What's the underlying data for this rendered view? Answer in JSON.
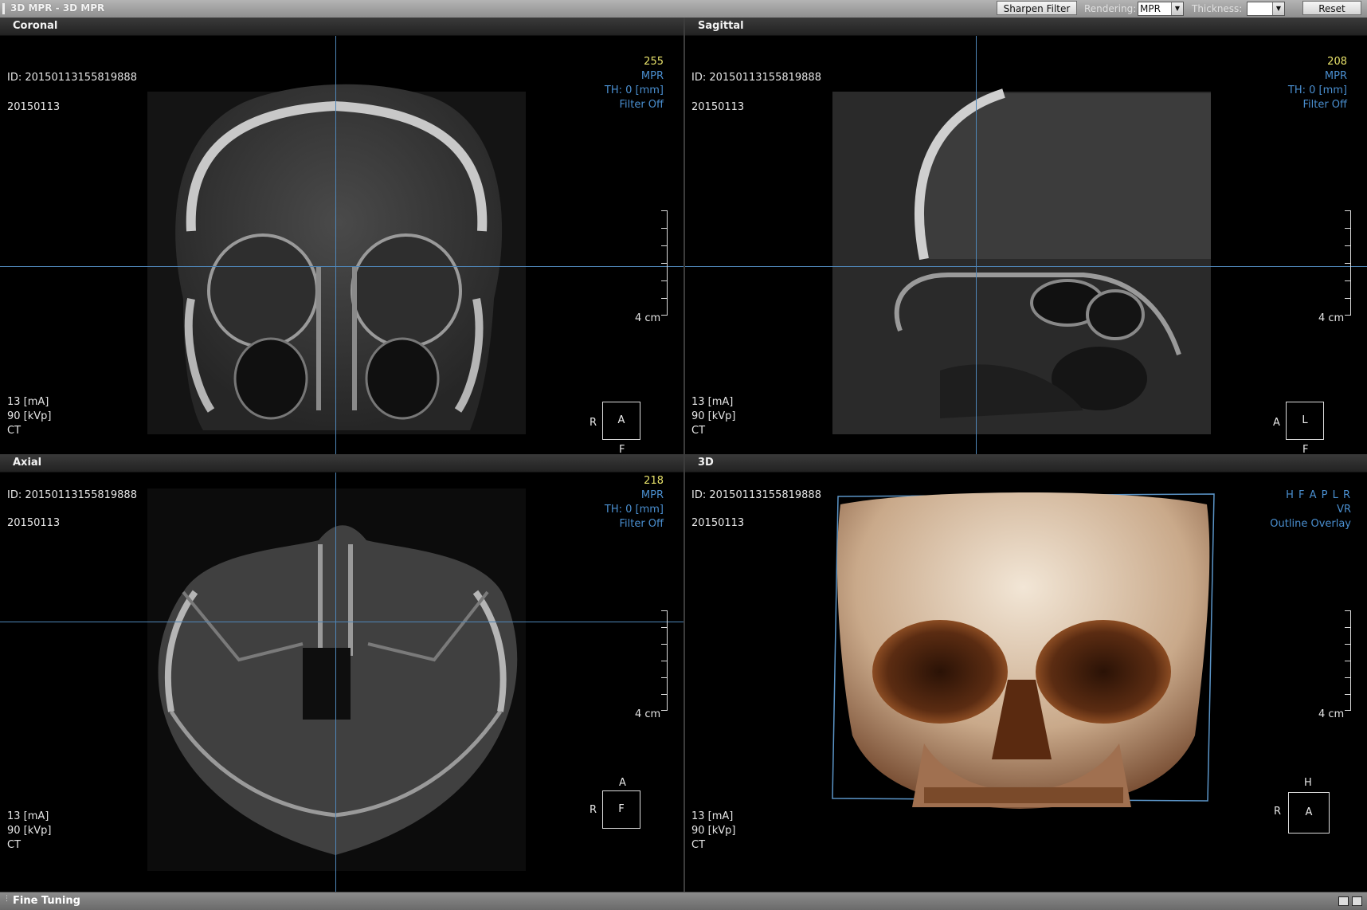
{
  "window": {
    "title": "3D MPR - 3D MPR",
    "sharpen_label": "Sharpen Filter",
    "rendering_label": "Rendering:",
    "rendering_value": "MPR",
    "thickness_label": "Thickness:",
    "thickness_value": "",
    "reset_label": "Reset"
  },
  "common": {
    "id": "ID: 20150113155819888",
    "date": "20150113",
    "ma": "13 [mA]",
    "kvp": "90 [kVp]",
    "modality": "CT",
    "scale": "4 cm"
  },
  "coronal": {
    "title": "Coronal",
    "slice": "255",
    "mode": "MPR",
    "th": "TH: 0 [mm]",
    "filter": "Filter Off",
    "orient_left": "R",
    "orient_center": "A",
    "orient_bottom": "F"
  },
  "sagittal": {
    "title": "Sagittal",
    "slice": "208",
    "mode": "MPR",
    "th": "TH: 0 [mm]",
    "filter": "Filter Off",
    "orient_left": "A",
    "orient_center": "L",
    "orient_bottom": "F"
  },
  "axial": {
    "title": "Axial",
    "slice": "218",
    "mode": "MPR",
    "th": "TH: 0 [mm]",
    "filter": "Filter Off",
    "orient_top": "A",
    "orient_left": "R",
    "orient_center": "F"
  },
  "view3d": {
    "title": "3D",
    "directions": "H F A P L R",
    "mode": "VR",
    "overlay": "Outline Overlay",
    "orient_top": "H",
    "orient_left": "R",
    "orient_center": "A"
  },
  "status": {
    "title": "Fine Tuning"
  },
  "colors": {
    "crosshair": "#4f86b8",
    "overlay_blue": "#4a8fd0",
    "slice_yellow": "#e8e26a"
  }
}
